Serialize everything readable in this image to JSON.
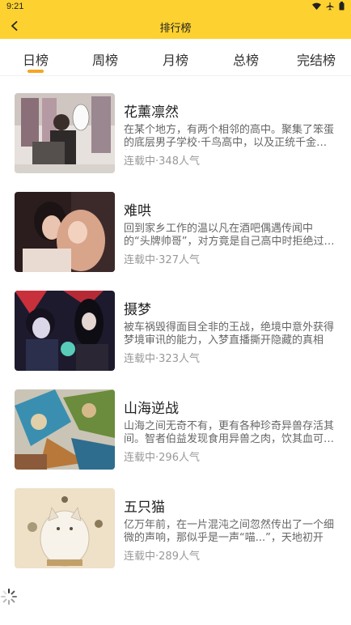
{
  "status": {
    "time": "9:21"
  },
  "header": {
    "title": "排行榜",
    "icons": [
      "back-arrow-icon"
    ]
  },
  "tabs": [
    {
      "label": "日榜",
      "active": true
    },
    {
      "label": "周榜",
      "active": false
    },
    {
      "label": "月榜",
      "active": false
    },
    {
      "label": "总榜",
      "active": false
    },
    {
      "label": "完结榜",
      "active": false
    }
  ],
  "colors": {
    "accent": "#fdd12f",
    "indicator": "#f6a623"
  },
  "comics": [
    {
      "title": "花薰凛然",
      "desc": "在某个地方，有两个相邻的高中。聚集了笨蛋的底层男子学校·千鸟高中，以及正统千金学校·桔梗女子",
      "status": "连载中",
      "popularity": "348人气"
    },
    {
      "title": "难哄",
      "desc": "回到家乡工作的温以凡在酒吧偶遇传闻中的“头牌帅哥”，对方竟是自己高中时拒绝过的桑延",
      "status": "连载中",
      "popularity": "327人气"
    },
    {
      "title": "摄梦",
      "desc": "被车祸毁得面目全非的王战，绝境中意外获得梦境审讯的能力，入梦直播撕开隐藏的真相",
      "status": "连载中",
      "popularity": "323人气"
    },
    {
      "title": "山海逆战",
      "desc": "山海之间无奇不有，更有各种珍奇异兽存活其间。智者伯益发现食用异兽之肉，饮其血可获得力量",
      "status": "连载中",
      "popularity": "296人气"
    },
    {
      "title": "五只猫",
      "desc": "亿万年前，在一片混沌之间忽然传出了一个细微的声响，那似乎是一声“喵...”，天地初开",
      "status": "连载中",
      "popularity": "289人气"
    }
  ]
}
